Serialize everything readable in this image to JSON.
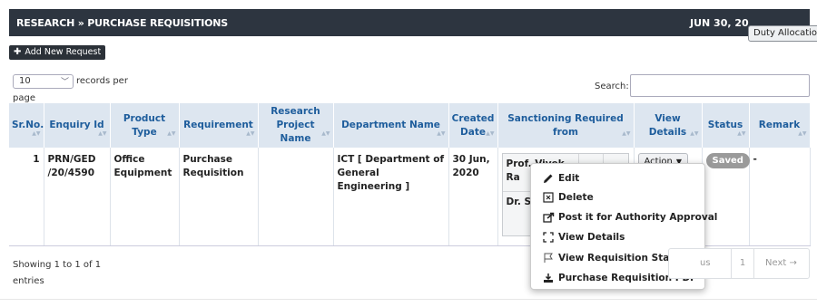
{
  "header": {
    "title": "RESEARCH » PURCHASE REQUISITIONS",
    "date": "JUN 30, 20",
    "tooltip": "Duty Allocation",
    "bg_color": "#2d3540"
  },
  "toolbar": {
    "add_label": "Add New Request",
    "add_icon": "plus-icon"
  },
  "length_control": {
    "value": "10",
    "suffix": "records per",
    "suffix2": "page"
  },
  "search": {
    "label": "Search:",
    "value": ""
  },
  "table": {
    "columns": [
      "Sr.No.",
      "Enquiry Id",
      "Product Type",
      "Requirement",
      "Research Project Name",
      "Department Name",
      "Created Date",
      "Sanctioning Required from",
      "View Details",
      "Status",
      "Remark"
    ],
    "rows": [
      {
        "sr": "1",
        "enquiry_id": "PRN/GED /20/4590",
        "product_type": "Office Equipment",
        "requirement": "Purchase Requisition",
        "project": "",
        "department": "ICT [ Department of General Engineering ]",
        "created": "30 Jun, 2020",
        "sanction": [
          {
            "name": "Prof. Vivek Ra",
            "c1": "-",
            "c2": "-"
          },
          {
            "name": "Dr. Sa HO",
            "c1": "",
            "c2": ""
          }
        ],
        "action_label": "Action",
        "status": "Saved",
        "remark": "-"
      }
    ]
  },
  "action_menu": [
    {
      "label": "Edit",
      "icon": "pencil-icon"
    },
    {
      "label": "Delete",
      "icon": "delete-box-icon"
    },
    {
      "label": "Post it for Authority Approval",
      "icon": "share-icon"
    },
    {
      "label": "View Details",
      "icon": "expand-icon"
    },
    {
      "label": "View Requisition Status",
      "icon": "flag-icon"
    },
    {
      "label": "Purchase Requisition PDF",
      "icon": "download-icon"
    }
  ],
  "footer": {
    "info_line1": "Showing 1 to 1 of 1",
    "info_line2": "entries",
    "prev_label": "us",
    "page": "1",
    "next_label": "Next →"
  },
  "colors": {
    "header_text": "#1e5d9c",
    "header_bg": "#dde6f0",
    "status_badge": "#9a9a9a"
  }
}
